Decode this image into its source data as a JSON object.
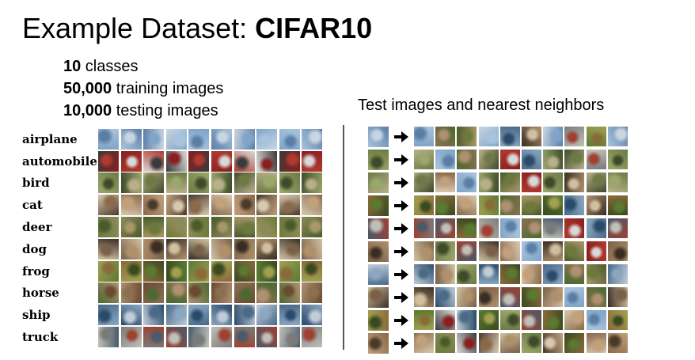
{
  "header": {
    "title_prefix": "Example Dataset: ",
    "title_bold": "CIFAR10"
  },
  "stats": [
    {
      "number": "10",
      "text": " classes"
    },
    {
      "number": "50,000",
      "text": " training images"
    },
    {
      "number": "10,000",
      "text": " testing images"
    }
  ],
  "classes": [
    "airplane",
    "automobile",
    "bird",
    "cat",
    "deer",
    "dog",
    "frog",
    "horse",
    "ship",
    "truck"
  ],
  "nearest_neighbors": {
    "title": "Test images and nearest neighbors"
  },
  "colors": {
    "airplane": [
      "#7fa4c8",
      "#a9c3dc",
      "#5a7ea6",
      "#c9d6e2"
    ],
    "automobile": [
      "#b03a2e",
      "#d9d9d9",
      "#3a3a3a",
      "#8a1f1f"
    ],
    "bird": [
      "#6d7a45",
      "#9aa86a",
      "#3f4a2a",
      "#b8b08a"
    ],
    "cat": [
      "#8a6a4a",
      "#c2a07a",
      "#4a3a2a",
      "#d8c8b0"
    ],
    "deer": [
      "#6b7a3a",
      "#8c8a5a",
      "#4a5a2a",
      "#a89868"
    ],
    "dog": [
      "#7a6048",
      "#b0906a",
      "#3a2e24",
      "#d0c0a0"
    ],
    "frog": [
      "#5a7a30",
      "#a0a050",
      "#8a6a3a",
      "#3a4a20"
    ],
    "horse": [
      "#6a4a30",
      "#8a7050",
      "#4a6a30",
      "#b09070"
    ],
    "ship": [
      "#4a6a8a",
      "#8aa6c0",
      "#2a4a6a",
      "#c0ccd8"
    ],
    "truck": [
      "#7a7a7a",
      "#a04030",
      "#4a5a6a",
      "#c0c0b8"
    ]
  }
}
